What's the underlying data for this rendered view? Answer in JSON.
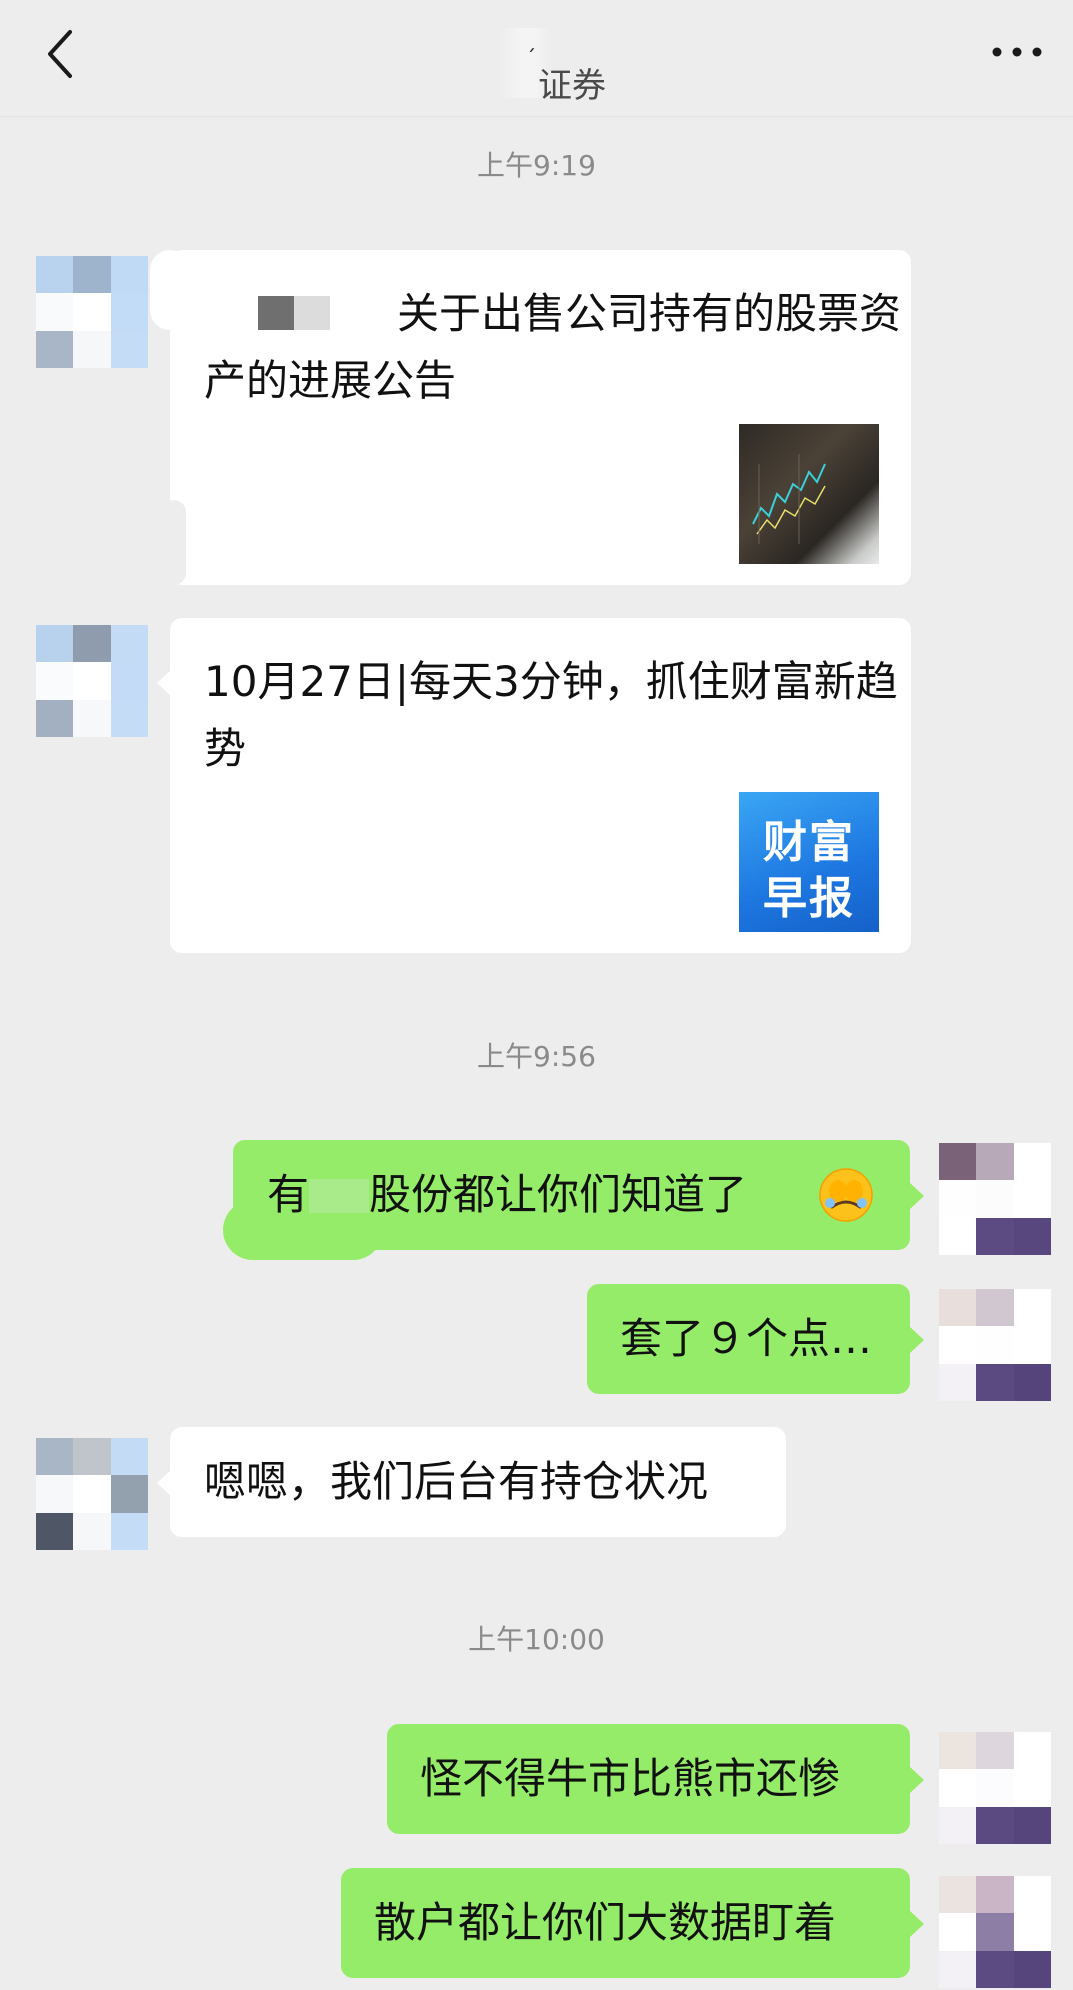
{
  "header": {
    "title": "证券",
    "back_icon": "chevron-left-icon",
    "more_icon": "more-dots-icon"
  },
  "timestamps": [
    "上午9:19",
    "上午9:56",
    "上午10:00"
  ],
  "messages": [
    {
      "type": "link-card",
      "side": "left",
      "title": "关于出售公司持有的股票资产的进展公告",
      "thumbnail": "stock-chart-thumbnail"
    },
    {
      "type": "link-card",
      "side": "left",
      "title": "10月27日|每天3分钟，抓住财富新趋势",
      "thumbnail_text": [
        "财富",
        "早报"
      ]
    },
    {
      "type": "text",
      "side": "right",
      "text": "有",
      "text2": "股份都让你们知道了",
      "emoji": "face-with-hand-over-eyes-emoji"
    },
    {
      "type": "text",
      "side": "right",
      "text": "套了９个点…"
    },
    {
      "type": "text",
      "side": "left",
      "text": "嗯嗯，我们后台有持仓状况"
    },
    {
      "type": "text",
      "side": "right",
      "text": "怪不得牛市比熊市还惨"
    },
    {
      "type": "text",
      "side": "right",
      "text": "散户都让你们大数据盯着"
    }
  ]
}
